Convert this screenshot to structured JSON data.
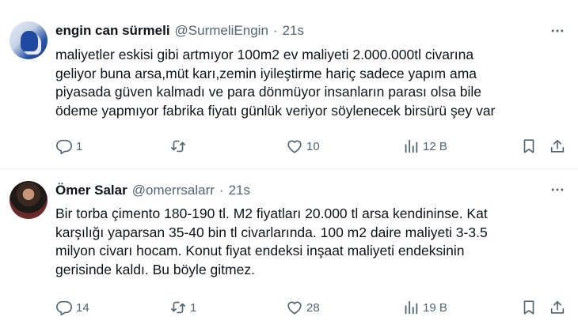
{
  "tweets": [
    {
      "name": "engin can sürmeli",
      "handle": "@SurmeliEngin",
      "separator": "·",
      "time": "21s",
      "lines": [
        "maliyetler eskisi gibi artmıyor 100m2 ev maliyeti 2.000.000tl civarına",
        "geliyor buna arsa,müt karı,zemin iyileştirme hariç sadece yapım ama",
        "piyasada güven kalmadı ve para dönmüyor insanların parası olsa bile",
        "ödeme yapmıyor fabrika fiyatı günlük veriyor söylenecek birsürü şey var"
      ],
      "replies": "1",
      "retweets": "",
      "likes": "10",
      "views": "12 B"
    },
    {
      "name": "Ömer Salar",
      "handle": "@omerrsalarr",
      "separator": "·",
      "time": "21s",
      "lines": [
        "Bir torba çimento 180-190 tl. M2 fiyatları 20.000 tl arsa kendininse. Kat",
        "karşılığı yaparsan 35-40 bin tl civarlarında. 100 m2 daire maliyeti 3-3.5",
        "milyon civarı hocam. Konut fiyat endeksi inşaat maliyeti endeksinin",
        "gerisinde kaldı. Bu böyle gitmez."
      ],
      "replies": "14",
      "retweets": "1",
      "likes": "28",
      "views": "19 B"
    }
  ],
  "icons": {
    "more": "more-horizontal-icon",
    "reply": "reply-icon",
    "retweet": "retweet-icon",
    "like": "heart-icon",
    "views": "views-bar-chart-icon",
    "bookmark": "bookmark-icon",
    "share": "share-icon"
  },
  "colors": {
    "text": "#0f1419",
    "secondary": "#536471",
    "divider": "#eff3f4"
  }
}
